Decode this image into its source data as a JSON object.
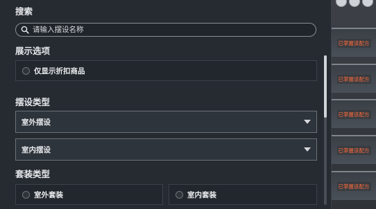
{
  "search": {
    "title": "搜索",
    "placeholder": "请输入摆设名称"
  },
  "display_options": {
    "title": "展示选项",
    "discount_only_label": "仅显示折扣商品"
  },
  "decoration_type": {
    "title": "摆设类型",
    "dropdowns": [
      {
        "label": "室外摆设"
      },
      {
        "label": "室内摆设"
      }
    ]
  },
  "set_type": {
    "title": "套装类型",
    "options": [
      {
        "label": "室外套装"
      },
      {
        "label": "室内套装"
      }
    ]
  },
  "side_cards": {
    "badge_label": "已掌握该配方"
  },
  "colors": {
    "panel_bg": "#262b32",
    "badge_text": "#ff6b3d"
  },
  "icons": {
    "search": "search-icon",
    "dropdown": "caret-down-icon"
  }
}
